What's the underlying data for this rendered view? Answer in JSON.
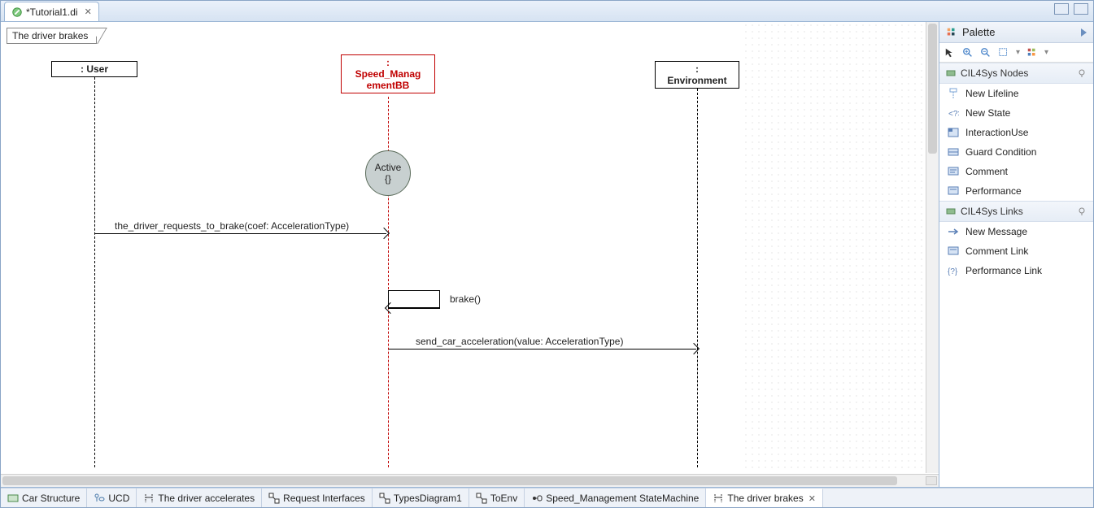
{
  "top_tab": {
    "title": "*Tutorial1.di"
  },
  "frame": {
    "label": "The driver brakes"
  },
  "lifelines": {
    "user": {
      "label": ": User"
    },
    "speed_mgmt": {
      "line1": ":",
      "line2": "Speed_Manag",
      "line3": "ementBB"
    },
    "environment": {
      "line1": ":",
      "line2": "Environment"
    }
  },
  "state": {
    "name": "Active",
    "body": "{}"
  },
  "messages": {
    "m1": "the_driver_requests_to_brake(coef: AccelerationType)",
    "m2": "brake()",
    "m3": "send_car_acceleration(value: AccelerationType)"
  },
  "bottom_tabs": [
    {
      "label": "Car Structure"
    },
    {
      "label": "UCD"
    },
    {
      "label": "The driver accelerates"
    },
    {
      "label": "Request Interfaces"
    },
    {
      "label": "TypesDiagram1"
    },
    {
      "label": "ToEnv"
    },
    {
      "label": "Speed_Management StateMachine"
    },
    {
      "label": "The driver brakes"
    }
  ],
  "palette": {
    "title": "Palette",
    "sections": {
      "nodes": {
        "title": "CIL4Sys Nodes",
        "items": [
          "New Lifeline",
          "New State",
          "InteractionUse",
          "Guard Condition",
          "Comment",
          "Performance"
        ]
      },
      "links": {
        "title": "CIL4Sys Links",
        "items": [
          "New Message",
          "Comment Link",
          "Performance Link"
        ]
      }
    }
  }
}
